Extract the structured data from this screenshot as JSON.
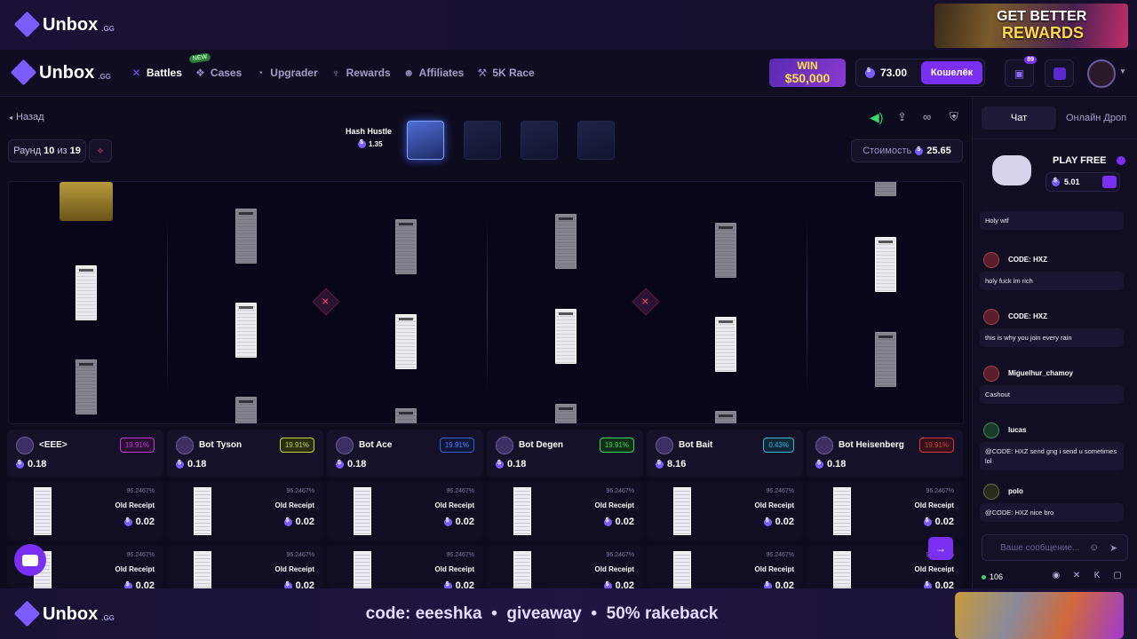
{
  "top_banner": {
    "logo_text": "Unbox",
    "logo_suffix": ".GG",
    "promo_line1": "GET BETTER",
    "promo_line2": "REWARDS"
  },
  "nav": {
    "logo_text": "Unbox",
    "logo_suffix": ".GG",
    "items": [
      {
        "label": "Battles",
        "icon": "swords-icon",
        "active": true
      },
      {
        "label": "Cases",
        "icon": "cases-icon",
        "badge": "NEW"
      },
      {
        "label": "Upgrader",
        "icon": "upgrader-icon"
      },
      {
        "label": "Rewards",
        "icon": "trophy-icon"
      },
      {
        "label": "Affiliates",
        "icon": "users-icon"
      },
      {
        "label": "5K Race",
        "icon": "race-icon"
      }
    ],
    "win_line1": "WIN",
    "win_line2": "$50,000",
    "balance": "73.00",
    "wallet_label": "Кошелёк",
    "cart_count": "89"
  },
  "battle": {
    "back_label": "Назад",
    "round_label": "Раунд",
    "round_current": "10",
    "round_of": "из",
    "round_total": "19",
    "case_name": "Hash Hustle",
    "case_price": "1.35",
    "cost_label": "Стоимость",
    "cost_value": "25.65"
  },
  "players": [
    {
      "name": "<EEE>",
      "pct": "19.91%",
      "value": "0.18",
      "pct_color": "#c23ad6"
    },
    {
      "name": "Bot Tyson",
      "pct": "19.91%",
      "value": "0.18",
      "pct_color": "#c9d63a"
    },
    {
      "name": "Bot Ace",
      "pct": "19.91%",
      "value": "0.18",
      "pct_color": "#3a5ad6"
    },
    {
      "name": "Bot Degen",
      "pct": "19.91%",
      "value": "0.18",
      "pct_color": "#3ad65a"
    },
    {
      "name": "Bot Bait",
      "pct": "0.43%",
      "value": "8.16",
      "pct_color": "#3ab8d6"
    },
    {
      "name": "Bot Heisenberg",
      "pct": "19.91%",
      "value": "0.18",
      "pct_color": "#d63a4a"
    }
  ],
  "item_row": {
    "odds": "96.2467%",
    "name": "Old Receipt",
    "price": "0.02"
  },
  "chat": {
    "tab_chat": "Чат",
    "tab_drops": "Онлайн Дроп",
    "play_free_label": "PLAY FREE",
    "play_free_value": "5.01",
    "messages": [
      {
        "user": "",
        "text": "Holy wtf"
      },
      {
        "user": "CODE: HXZ",
        "text": "holy fuck im rich"
      },
      {
        "user": "CODE: HXZ",
        "text": "this is why you join every rain"
      },
      {
        "user": "Miguelhur_chamoy",
        "text": "Cashout"
      },
      {
        "user": "lucas",
        "text": "@CODE: HXZ send gng i send u sometimes lol"
      },
      {
        "user": "polo",
        "text": "@CODE: HXZ nice bro"
      }
    ],
    "input_placeholder": "Ваше сообщение...",
    "online_count": "106"
  },
  "bottom_banner": {
    "logo_text": "Unbox",
    "logo_suffix": ".GG",
    "promo_text": "code: eeeshka  •  giveaway  •  50% rakeback"
  }
}
